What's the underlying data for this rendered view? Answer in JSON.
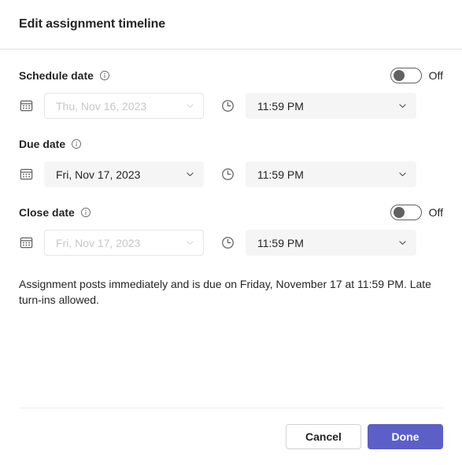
{
  "dialog": {
    "title": "Edit assignment timeline"
  },
  "fields": [
    {
      "key": "schedule",
      "label": "Schedule date",
      "info_icon": "info-icon",
      "has_toggle": true,
      "toggle_state": "Off",
      "date": {
        "icon": "calendar-icon",
        "value": "Thu, Nov 16, 2023",
        "enabled": false
      },
      "time": {
        "icon": "clock-icon",
        "value": "11:59 PM",
        "enabled": true
      }
    },
    {
      "key": "due",
      "label": "Due date",
      "info_icon": "info-icon",
      "has_toggle": false,
      "toggle_state": "",
      "date": {
        "icon": "calendar-icon",
        "value": "Fri, Nov 17, 2023",
        "enabled": true
      },
      "time": {
        "icon": "clock-icon",
        "value": "11:59 PM",
        "enabled": true
      }
    },
    {
      "key": "close",
      "label": "Close date",
      "info_icon": "info-icon",
      "has_toggle": true,
      "toggle_state": "Off",
      "date": {
        "icon": "calendar-icon",
        "value": "Fri, Nov 17, 2023",
        "enabled": false
      },
      "time": {
        "icon": "clock-icon",
        "value": "11:59 PM",
        "enabled": true
      }
    }
  ],
  "summary": {
    "text": "Assignment posts immediately and is due on Friday, November 17 at 11:59 PM. Late turn-ins allowed."
  },
  "footer": {
    "cancel_label": "Cancel",
    "done_label": "Done"
  },
  "colors": {
    "accent": "#5b5fc7",
    "text": "#242424",
    "disabled_text": "#c7c7c7",
    "field_fill": "#f5f5f5",
    "border": "#e0e0e0"
  }
}
